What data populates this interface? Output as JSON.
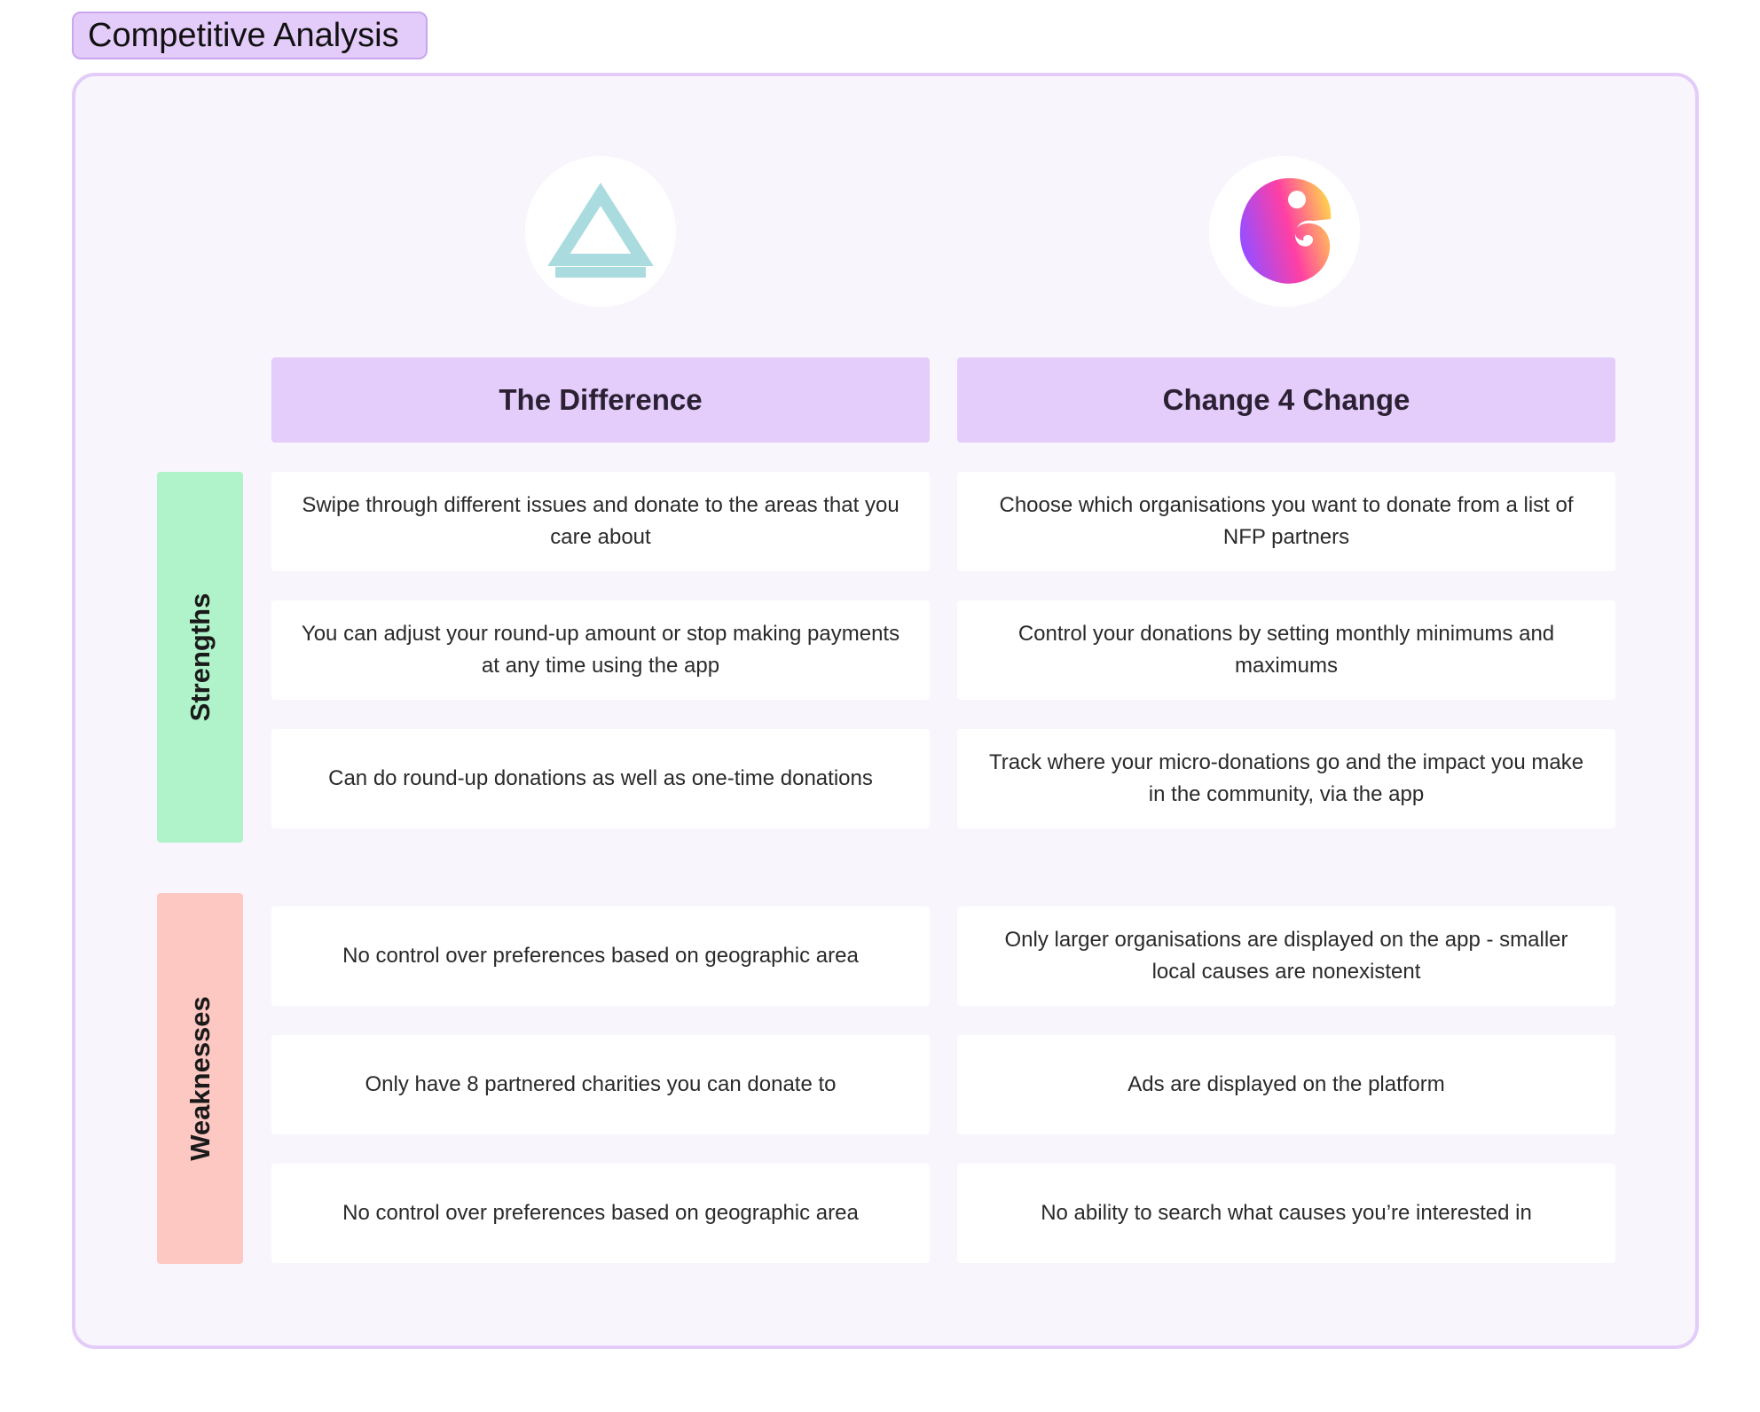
{
  "frame": {
    "title": "Competitive Analysis"
  },
  "competitors": [
    {
      "name": "The Difference",
      "logo_icon": "triangle-logo-icon",
      "logo_color": "#a9dbdf"
    },
    {
      "name": "Change 4 Change",
      "logo_icon": "chameleon-logo-icon",
      "logo_colors": [
        "#9a4dff",
        "#ff3fa4",
        "#ffd84a"
      ]
    }
  ],
  "rows": {
    "strengths": {
      "label": "Strengths",
      "color": "#b0f2c9",
      "cells": [
        [
          "Swipe through different issues and donate to the areas that you care about",
          "Choose which organisations you want to donate from a list of NFP partners"
        ],
        [
          "You can adjust your round-up amount or stop making payments at any time using the app",
          "Control your donations by setting monthly minimums and maximums"
        ],
        [
          "Can do round-up donations as well as one-time donations",
          "Track where your micro-donations go and the impact you make in the community, via the app"
        ]
      ]
    },
    "weaknesses": {
      "label": "Weaknesses",
      "color": "#fdc7c2",
      "cells": [
        [
          "No control over preferences based on geographic area",
          "Only larger organisations are displayed on the app - smaller local causes are nonexistent"
        ],
        [
          "Only have 8 partnered charities you can donate to",
          "Ads are displayed on the platform"
        ],
        [
          "No control over preferences based on geographic area",
          "No ability to search what causes you’re interested in"
        ]
      ]
    }
  }
}
